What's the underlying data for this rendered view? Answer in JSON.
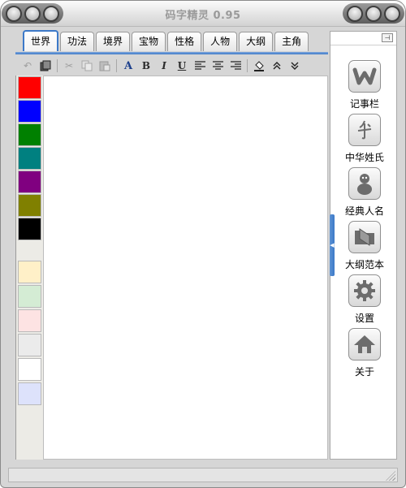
{
  "window": {
    "title": "码字精灵 0.95"
  },
  "tabs": [
    {
      "label": "世界",
      "active": true
    },
    {
      "label": "功法",
      "active": false
    },
    {
      "label": "境界",
      "active": false
    },
    {
      "label": "宝物",
      "active": false
    },
    {
      "label": "性格",
      "active": false
    },
    {
      "label": "人物",
      "active": false
    },
    {
      "label": "大纲",
      "active": false
    },
    {
      "label": "主角",
      "active": false
    }
  ],
  "toolbar": {
    "buttons": [
      {
        "name": "undo-icon",
        "glyph": "↶",
        "enabled": false
      },
      {
        "name": "copy-format-icon",
        "glyph": "▣",
        "enabled": true
      },
      {
        "name": "cut-icon",
        "glyph": "✂",
        "enabled": false
      },
      {
        "name": "copy-icon",
        "glyph": "⧉",
        "enabled": false
      },
      {
        "name": "paste-icon",
        "glyph": "📋",
        "enabled": false
      },
      {
        "name": "font-icon",
        "glyph": "A",
        "enabled": true
      },
      {
        "name": "bold-icon",
        "glyph": "B",
        "enabled": true
      },
      {
        "name": "italic-icon",
        "glyph": "I",
        "enabled": true
      },
      {
        "name": "underline-icon",
        "glyph": "U",
        "enabled": true
      },
      {
        "name": "align-left-icon",
        "glyph": "≡",
        "enabled": true
      },
      {
        "name": "align-center-icon",
        "glyph": "≡",
        "enabled": true
      },
      {
        "name": "align-right-icon",
        "glyph": "≡",
        "enabled": true
      },
      {
        "name": "fill-color-icon",
        "glyph": "◈",
        "enabled": true
      },
      {
        "name": "collapse-up-icon",
        "glyph": "︽",
        "enabled": true
      },
      {
        "name": "expand-down-icon",
        "glyph": "︾",
        "enabled": true
      }
    ]
  },
  "palette": {
    "strong": [
      "#ff0000",
      "#0000ff",
      "#008000",
      "#008080",
      "#800080",
      "#808000",
      "#000000"
    ],
    "light": [
      "#fff0c8",
      "#d4ecd4",
      "#fde3e3",
      "#ebebeb",
      "#ffffff",
      "#dde2fb"
    ]
  },
  "side_panel": {
    "pin_glyph": "⊣",
    "items": [
      {
        "name": "notes",
        "icon": "notes-icon",
        "label": "记事栏"
      },
      {
        "name": "surnames",
        "icon": "surname-icon",
        "label": "中华姓氏"
      },
      {
        "name": "classic-names",
        "icon": "person-icon",
        "label": "经典人名"
      },
      {
        "name": "outline-templates",
        "icon": "folder-icon",
        "label": "大纲范本"
      },
      {
        "name": "settings",
        "icon": "gear-icon",
        "label": "设置"
      },
      {
        "name": "about",
        "icon": "home-icon",
        "label": "关于"
      }
    ]
  },
  "colors": {
    "accent": "#3c79c8",
    "icon_dark": "#6c6c6c"
  }
}
